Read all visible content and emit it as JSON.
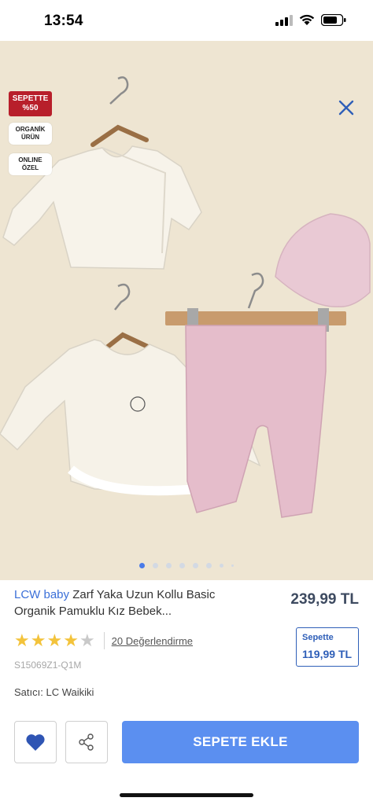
{
  "status_bar": {
    "time": "13:54"
  },
  "gallery": {
    "badges": {
      "sale": "SEPETTE\n%50",
      "organic": "ORGANİK\nÜRÜN",
      "online": "ONLINE\nÖZEL"
    },
    "image_count": 8,
    "active_index": 0
  },
  "product": {
    "brand": "LCW baby",
    "title": " Zarf Yaka Uzun Kollu Basic Organik Pamuklu Kız Bebek...",
    "price": "239,99 TL",
    "rating": 4,
    "rating_max": 5,
    "reviews_label": "20 Değerlendirme",
    "cart_price_label": "Sepette",
    "cart_price_value": "119,99 TL",
    "sku": "S15069Z1-Q1M",
    "seller": "Satıcı: LC Waikiki"
  },
  "actions": {
    "add_to_cart_label": "SEPETE EKLE"
  },
  "colors": {
    "accent": "#5b8ff0",
    "brand": "#3a6fd8",
    "sale_badge": "#b81f2b",
    "favorite": "#2f55b4",
    "star": "#f3c33b"
  }
}
